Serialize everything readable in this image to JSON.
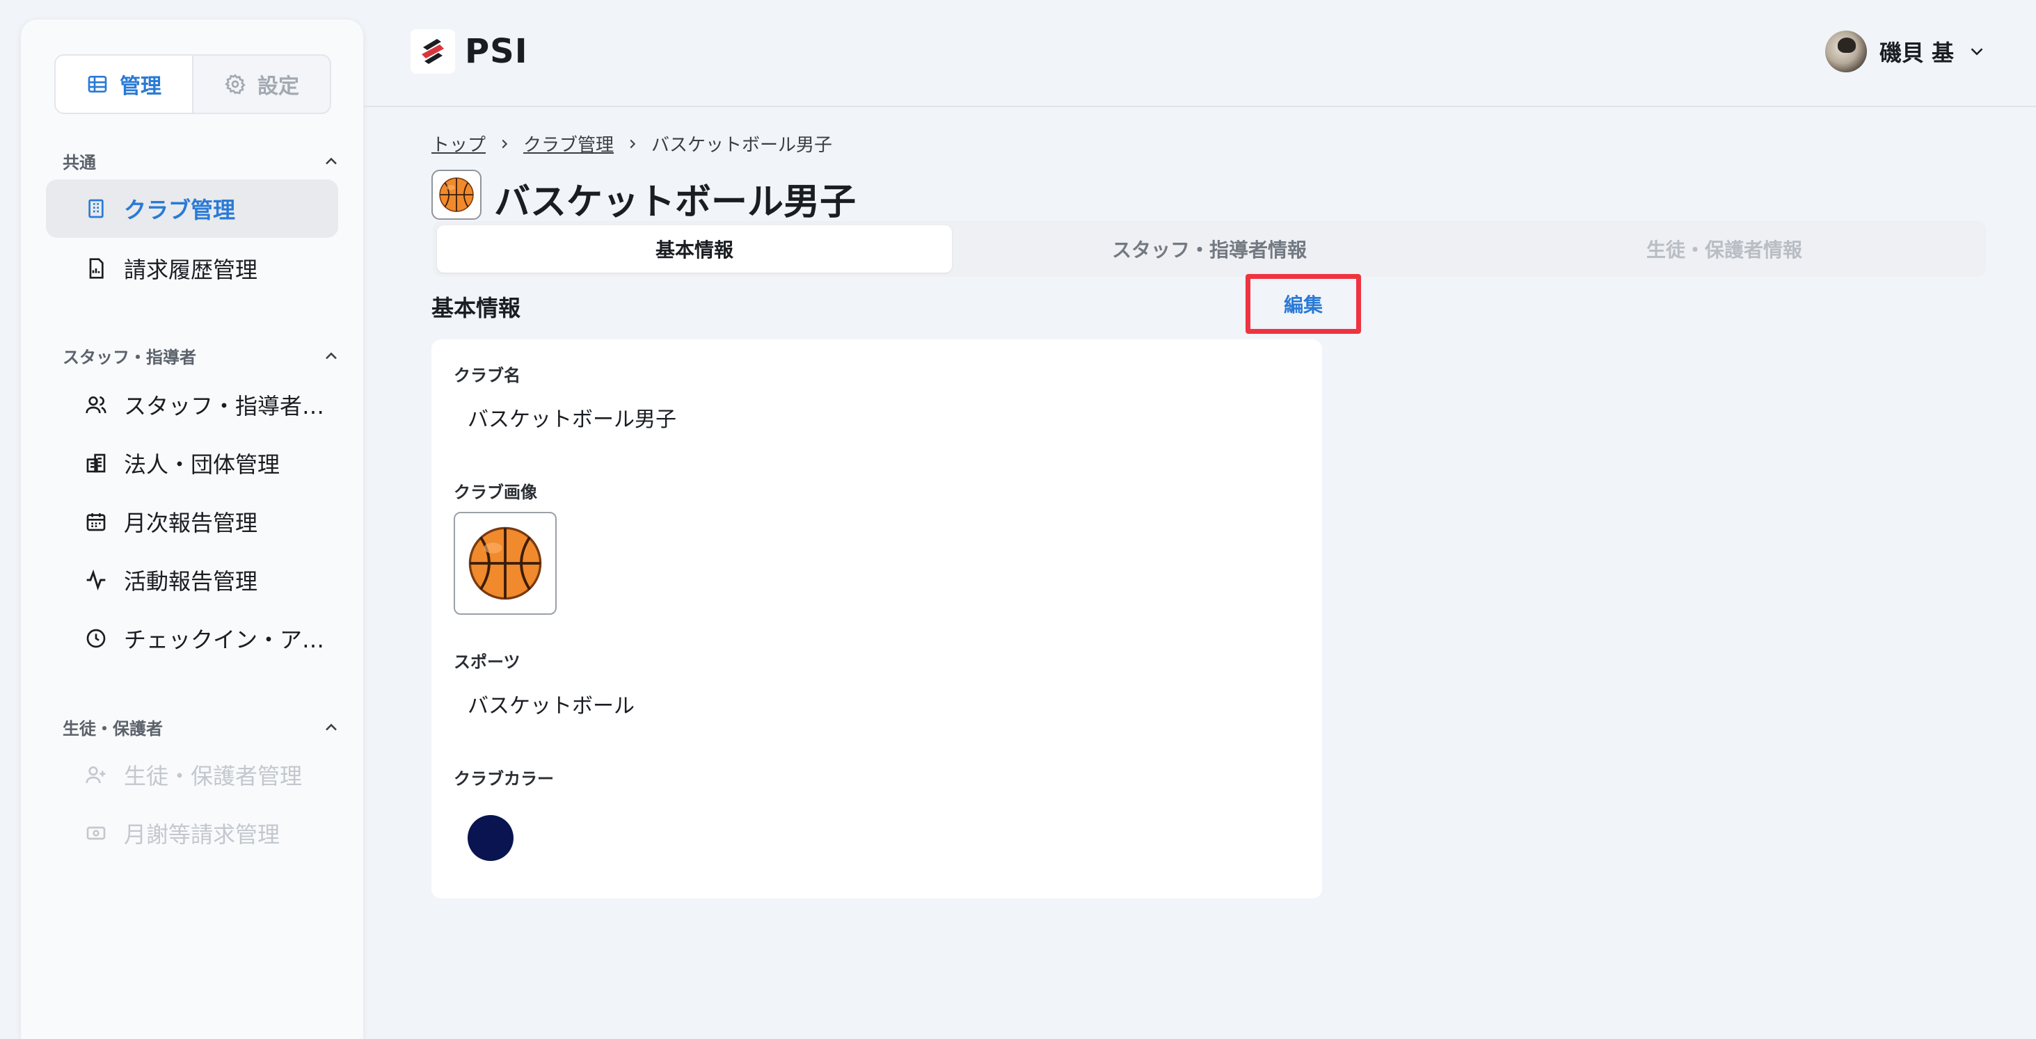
{
  "sidebar": {
    "mode_manage": "管理",
    "mode_settings": "設定",
    "sections": [
      {
        "title": "共通"
      },
      {
        "title": "スタッフ・指導者"
      },
      {
        "title": "生徒・保護者"
      }
    ],
    "items": [
      {
        "label": "クラブ管理",
        "icon": "building-icon"
      },
      {
        "label": "請求履歴管理",
        "icon": "invoice-icon"
      },
      {
        "label": "スタッフ・指導者管理",
        "icon": "users-icon"
      },
      {
        "label": "法人・団体管理",
        "icon": "organization-icon"
      },
      {
        "label": "月次報告管理",
        "icon": "calendar-icon"
      },
      {
        "label": "活動報告管理",
        "icon": "activity-icon"
      },
      {
        "label": "チェックイン・アウト管理",
        "icon": "clock-icon"
      },
      {
        "label": "生徒・保護者管理",
        "icon": "user-plus-icon"
      },
      {
        "label": "月謝等請求管理",
        "icon": "payment-icon"
      }
    ]
  },
  "header": {
    "app_name": "PSI",
    "user_name": "磯貝 基"
  },
  "breadcrumb": {
    "top": "トップ",
    "club_mgmt": "クラブ管理",
    "current": "バスケットボール男子"
  },
  "page": {
    "title": "バスケットボール男子",
    "tabs": [
      "基本情報",
      "スタッフ・指導者情報",
      "生徒・保護者情報"
    ],
    "section_title": "基本情報",
    "edit_label": "編集"
  },
  "fields": {
    "club_name_label": "クラブ名",
    "club_name_value": "バスケットボール男子",
    "club_image_label": "クラブ画像",
    "sport_label": "スポーツ",
    "sport_value": "バスケットボール",
    "club_color_label": "クラブカラー",
    "club_color_value": "#0a1450"
  },
  "colors": {
    "accent": "#2a7ad6",
    "highlight_border": "#ef3340"
  }
}
